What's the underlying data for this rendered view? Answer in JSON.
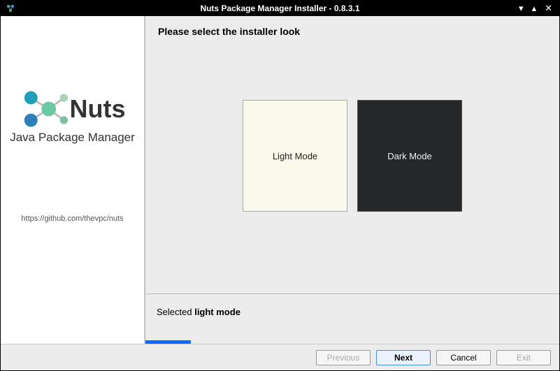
{
  "window": {
    "title": "Nuts Package Manager Installer - 0.8.3.1"
  },
  "sidebar": {
    "product": "Nuts",
    "tagline": "Java Package Manager",
    "repo": "https://github.com/thevpc/nuts"
  },
  "content": {
    "heading": "Please select the installer look",
    "light_label": "Light Mode",
    "dark_label": "Dark Mode"
  },
  "status": {
    "prefix": "Selected ",
    "mode": "light mode"
  },
  "buttons": {
    "previous": "Previous",
    "next": "Next",
    "cancel": "Cancel",
    "exit": "Exit"
  }
}
